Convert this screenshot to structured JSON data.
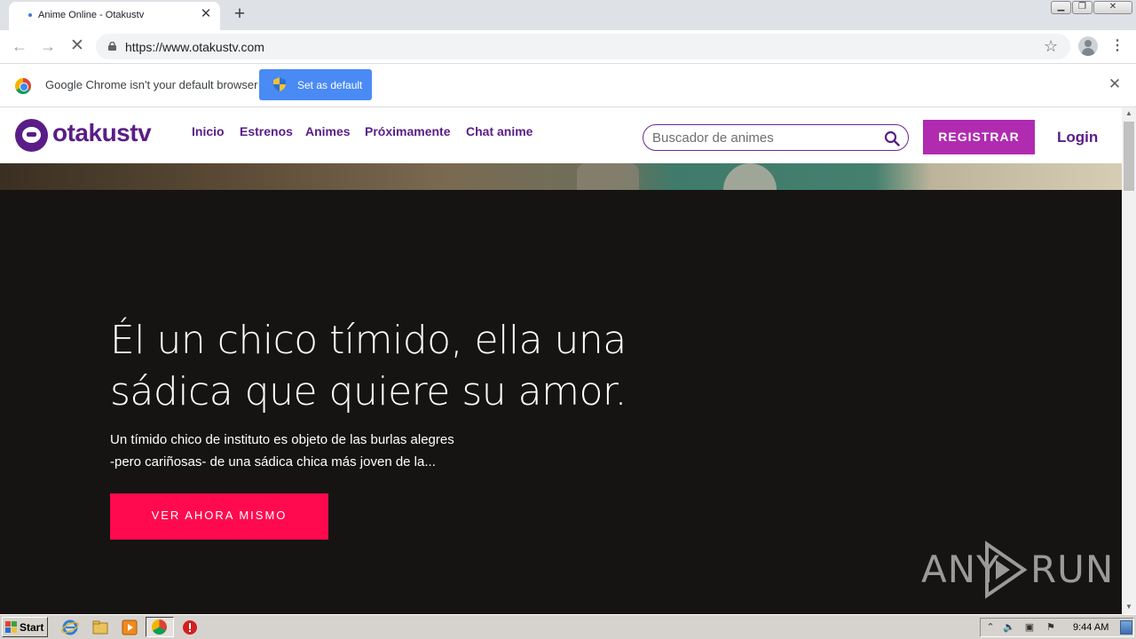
{
  "browser": {
    "tab": {
      "title": "Anime Online - Otakustv"
    },
    "url": "https://www.otakustv.com",
    "infobar": {
      "message": "Google Chrome isn't your default browser",
      "button_label": "Set as default"
    }
  },
  "site": {
    "logo_text": "otakustv",
    "nav": [
      "Inicio",
      "Estrenos",
      "Animes",
      "Próximamente",
      "Chat anime"
    ],
    "search_placeholder": "Buscador de animes",
    "register_label": "REGISTRAR",
    "login_label": "Login",
    "hero": {
      "title_line1": "Él un chico tímido, ella una",
      "title_line2": "sádica que quiere su amor.",
      "desc_line1": "Un tímido chico de instituto es objeto de las burlas alegres",
      "desc_line2": "-pero cariñosas- de una sádica chica más joven de la...",
      "cta_label": "VER AHORA MISMO"
    },
    "watermark": {
      "left": "ANY",
      "right": "RUN"
    }
  },
  "taskbar": {
    "start_label": "Start",
    "clock": "9:44 AM"
  },
  "colors": {
    "brand_purple": "#5a1d87",
    "register_magenta": "#b02bb0",
    "cta_red": "#ff0a4e",
    "hero_bg": "#161412",
    "infobar_button_blue": "#4a8af4"
  }
}
